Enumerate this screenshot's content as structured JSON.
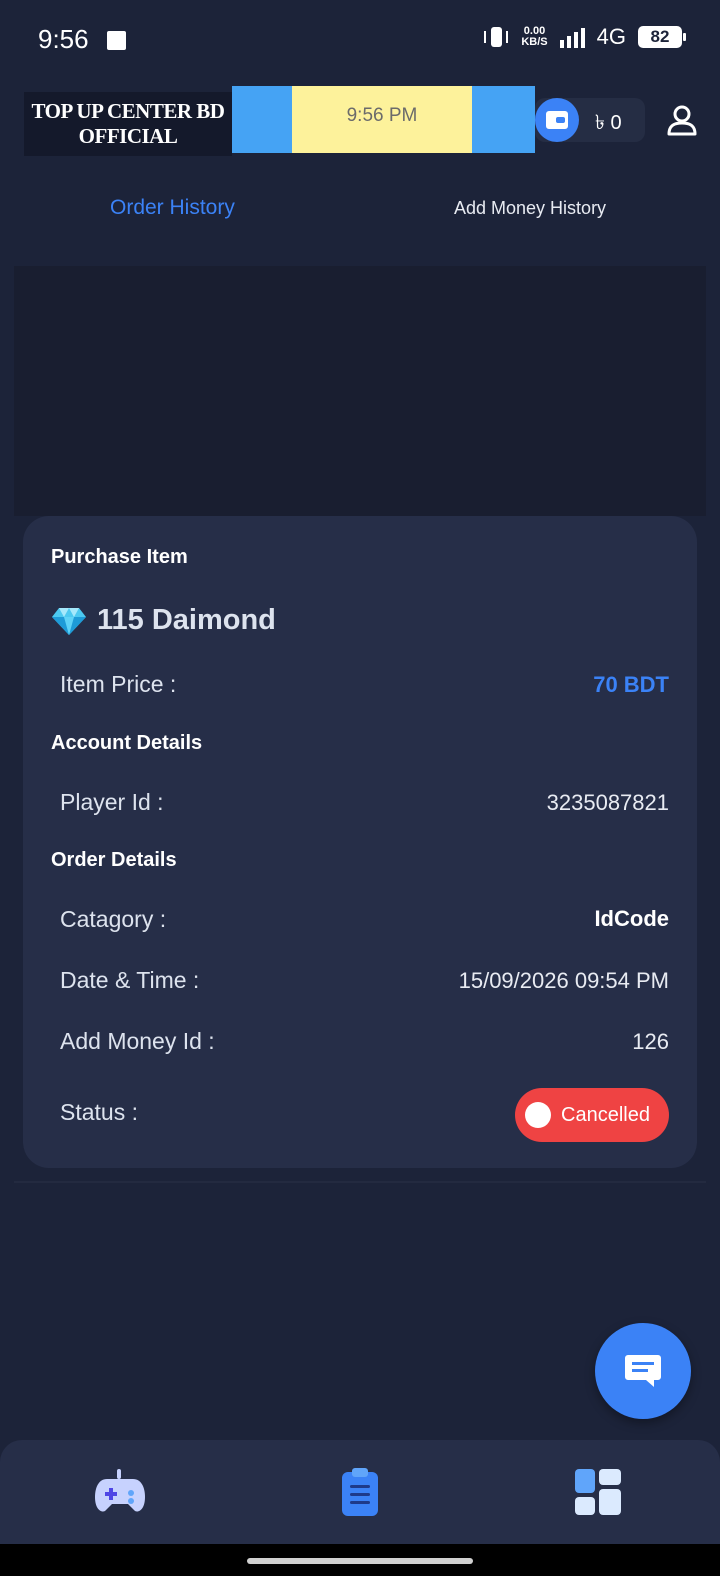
{
  "status_bar": {
    "time": "9:56",
    "speed_value": "0.00",
    "speed_unit": "KB/S",
    "network": "4G",
    "battery": "82"
  },
  "header": {
    "logo_line1": "TOP UP CENTER BD",
    "logo_line2": "OFFICIAL",
    "banner_time": "9:56 PM",
    "balance": "৳ 0",
    "icons": [
      "wallet-icon",
      "profile-icon"
    ]
  },
  "tabs": [
    {
      "label": "Order History",
      "active": true
    },
    {
      "label": "Add Money History",
      "active": false
    }
  ],
  "order": {
    "purchase_title": "Purchase Item",
    "item_name": "115 Daimond",
    "item_price_label": "Item Price :",
    "item_price": "70 BDT",
    "account_title": "Account Details",
    "player_id_label": "Player Id :",
    "player_id": "3235087821",
    "order_title": "Order Details",
    "category_label": "Catagory :",
    "category": "IdCode",
    "datetime_label": "Date & Time :",
    "datetime": "15/09/2026 09:54 PM",
    "add_money_id_label": "Add Money Id :",
    "add_money_id": "126",
    "status_label": "Status :",
    "status": "Cancelled"
  },
  "colors": {
    "background": "#1c2339",
    "card": "#262e48",
    "accent": "#3b82f6",
    "status_cancelled": "#ef4343"
  },
  "bottom_nav": [
    "gamepad-icon",
    "orders-icon",
    "dashboard-icon"
  ]
}
